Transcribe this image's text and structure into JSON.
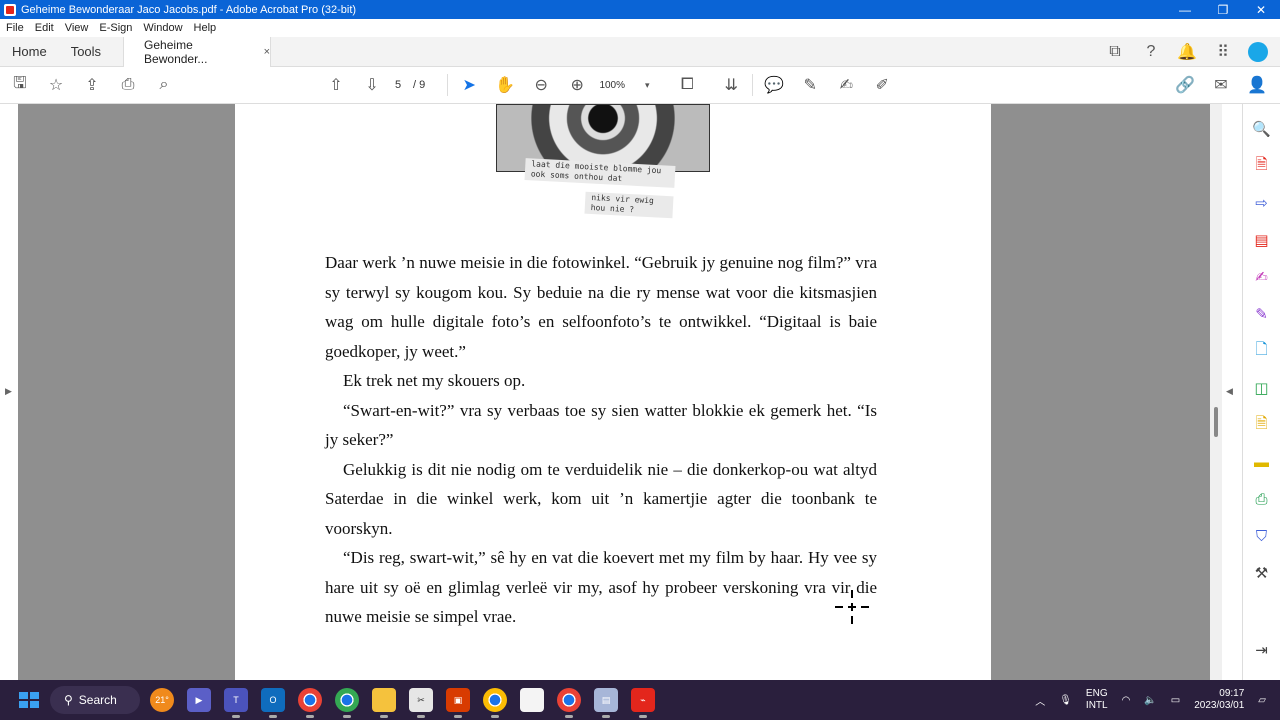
{
  "window": {
    "title": "Geheime Bewonderaar Jaco Jacobs.pdf - Adobe Acrobat Pro (32-bit)",
    "minimize": "—",
    "maximize": "❐",
    "close": "✕"
  },
  "menu": [
    "File",
    "Edit",
    "View",
    "E-Sign",
    "Window",
    "Help"
  ],
  "tabs": {
    "home": "Home",
    "tools": "Tools",
    "document": "Geheime Bewonder...",
    "close": "×"
  },
  "toolbar": {
    "page_current": "5",
    "page_total": "/ 9",
    "zoom": "100%"
  },
  "document": {
    "caption_1": "laat die mooiste blomme jou ook soms onthou dat",
    "caption_2": "niks vir ewig hou nie ?",
    "paragraphs": [
      "Daar werk ’n nuwe meisie in die fotowinkel. “Gebruik jy genuine nog film?” vra sy terwyl sy kougom kou. Sy beduie na die ry mense wat voor die kitsmasjien wag om hulle digitale foto’s en selfoonfoto’s te ontwikkel. “Digitaal is baie goedkoper, jy weet.”",
      "Ek trek net my skouers op.",
      "“Swart-en-wit?” vra sy verbaas toe sy sien watter blokkie ek gemerk het. “Is jy seker?”",
      "Gelukkig is dit nie nodig om te verduidelik nie – die donkerkop-ou wat altyd Saterdae in die winkel werk, kom uit ’n kamertjie agter die toonbank te voorskyn.",
      "“Dis reg, swart-wit,” sê hy en vat die koevert met my film by haar. Hy vee sy hare uit sy oë en glimlag verleë vir my, asof hy probeer verskoning vra vir die nuwe meisie se simpel vrae."
    ]
  },
  "taskbar": {
    "search": "Search",
    "weather": "21°",
    "lang_1": "ENG",
    "lang_2": "INTL",
    "time": "09:17",
    "date": "2023/03/01"
  },
  "colors": {
    "titlebar": "#0a64d6",
    "canvas": "#8f8f8f",
    "taskbar": "#2a1f3d",
    "acrobat_red": "#e3261c"
  }
}
